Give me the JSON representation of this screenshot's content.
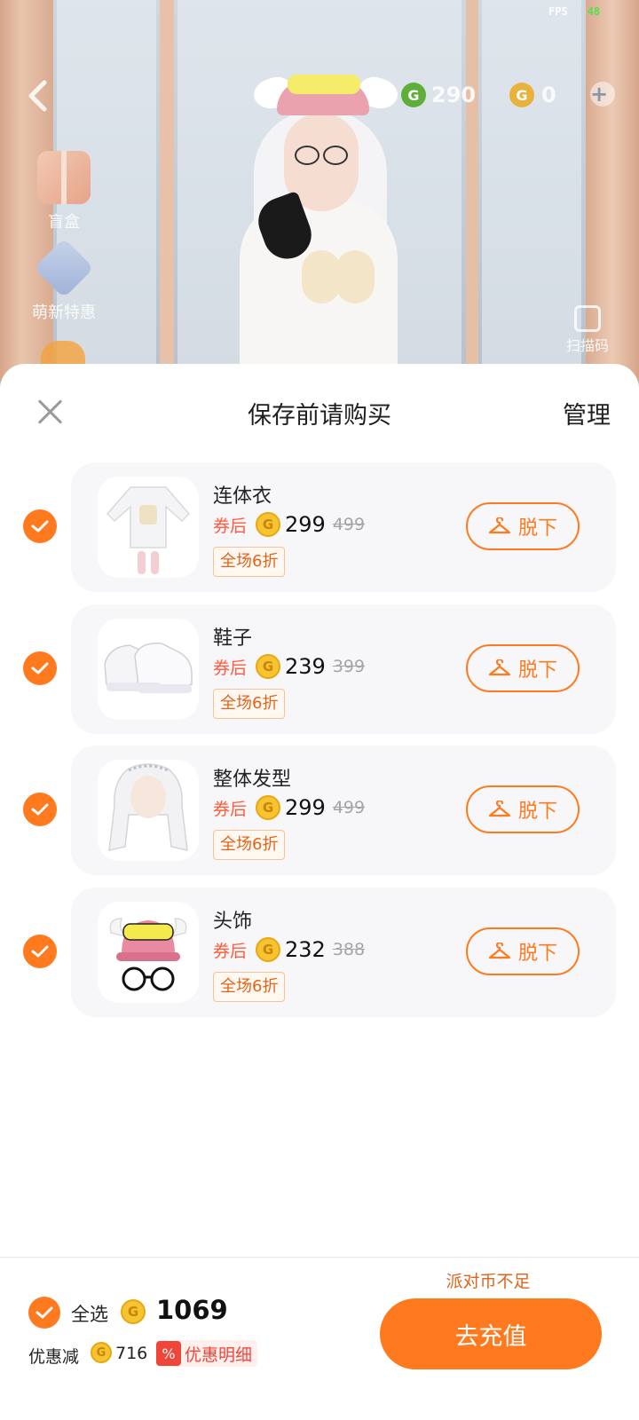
{
  "status": {
    "fps_label": "FPS",
    "fps_value": "48"
  },
  "scene": {
    "currency_green": "290",
    "currency_gold": "0",
    "plus": "+",
    "side_gift_label": "盲盒",
    "side_new_label": "萌新特惠",
    "code_label": "扫描码"
  },
  "sheet": {
    "title": "保存前请购买",
    "manage": "管理",
    "items": [
      {
        "name": "连体衣",
        "coupon_label": "券后",
        "price": "299",
        "original_price": "499",
        "discount": "全场6折",
        "action": "脱下",
        "thumb_icon": "onesie-icon"
      },
      {
        "name": "鞋子",
        "coupon_label": "券后",
        "price": "239",
        "original_price": "399",
        "discount": "全场6折",
        "action": "脱下",
        "thumb_icon": "shoes-icon"
      },
      {
        "name": "整体发型",
        "coupon_label": "券后",
        "price": "299",
        "original_price": "499",
        "discount": "全场6折",
        "action": "脱下",
        "thumb_icon": "hair-icon"
      },
      {
        "name": "头饰",
        "coupon_label": "券后",
        "price": "232",
        "original_price": "388",
        "discount": "全场6折",
        "action": "脱下",
        "thumb_icon": "headwear-icon"
      }
    ]
  },
  "footer": {
    "select_all": "全选",
    "total": "1069",
    "discount_label": "优惠减",
    "discount_amount": "716",
    "discount_detail_icon": "%",
    "discount_detail": "优惠明细",
    "insufficient": "派对币不足",
    "recharge": "去充值"
  },
  "colors": {
    "accent": "#ff7a1f",
    "coupon": "#ff5b3a",
    "coin": "#f6c430"
  }
}
